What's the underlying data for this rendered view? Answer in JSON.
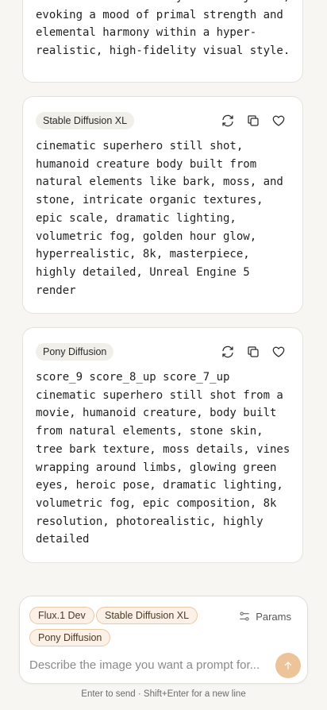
{
  "cards": [
    {
      "text": "bark-like skin and crystalline joints,\nevoking a mood of primal strength and\nelemental harmony within a hyper-\nrealistic, high-fidelity visual style."
    },
    {
      "model": "Stable Diffusion XL",
      "text": "cinematic superhero still shot,\nhumanoid creature body built from\nnatural elements like bark, moss, and\nstone, intricate organic textures,\nepic scale, dramatic lighting,\nvolumetric fog, golden hour glow,\nhyperrealistic, 8k, masterpiece,\nhighly detailed, Unreal Engine 5\nrender"
    },
    {
      "model": "Pony Diffusion",
      "text": "score_9 score_8_up score_7_up\ncinematic superhero still shot from a\nmovie, humanoid creature, body built\nfrom natural elements, stone skin,\ntree bark texture, moss details, vines\nwrapping around limbs, glowing green\neyes, heroic pose, dramatic lighting,\nvolumetric fog, epic composition, 8k\nresolution, photorealistic, highly\ndetailed"
    }
  ],
  "composer": {
    "chips": [
      "Flux.1 Dev",
      "Stable Diffusion XL",
      "Pony Diffusion"
    ],
    "params_label": "Params",
    "placeholder": "Describe the image you want a prompt for..."
  },
  "hint": "Enter to send · Shift+Enter for a new line",
  "colors": {
    "accent": "#edc49a",
    "chip_border": "#e9c9a4",
    "chip_bg": "#fbf1e6"
  },
  "icons": [
    "regenerate-icon",
    "copy-icon",
    "heart-icon",
    "sliders-icon",
    "arrow-up-icon"
  ]
}
